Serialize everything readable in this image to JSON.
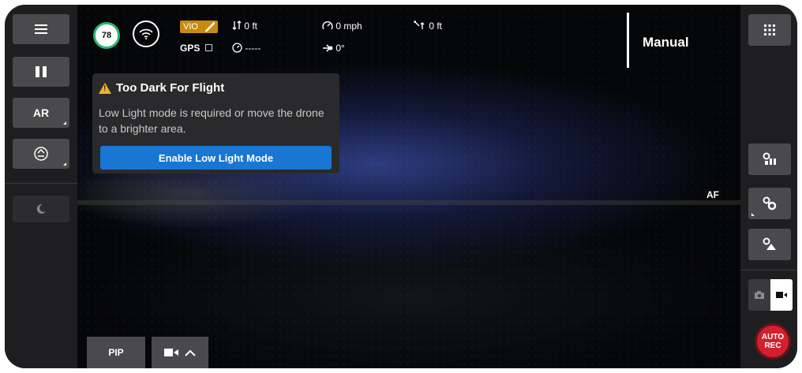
{
  "status": {
    "battery_percent": "78",
    "vio_label": "VIO",
    "gps_label": "GPS",
    "altitude": "0 ft",
    "speed": "0 mph",
    "distance": "0 ft",
    "compass_value": "-----",
    "heading": "0°",
    "flight_mode": "Manual"
  },
  "alert": {
    "title": "Too Dark For Flight",
    "message": "Low Light mode is required or move the drone to a brighter area.",
    "button_label": "Enable Low Light Mode"
  },
  "left_toolbar": {
    "ar_label": "AR"
  },
  "camera_view": {
    "af_label": "AF"
  },
  "bottom_bar": {
    "pip_label": "PIP"
  },
  "record_button": {
    "line1": "AUTO",
    "line2": "REC"
  },
  "colors": {
    "accent_blue": "#1976d2",
    "battery_green": "#2bb673",
    "vio_amber": "#c98a12",
    "record_red": "#d3202e",
    "warning_yellow": "#f0b323"
  }
}
